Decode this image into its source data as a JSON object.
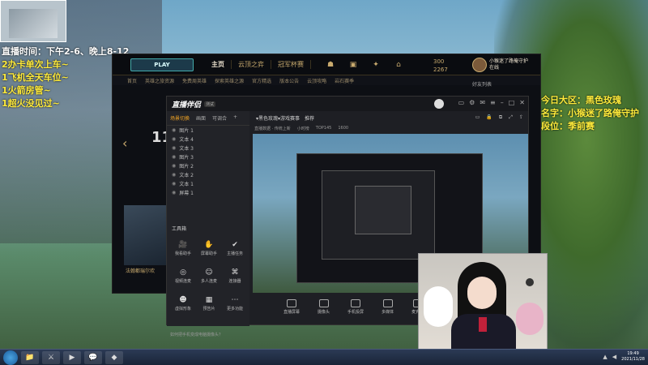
{
  "overlay_left": {
    "lines": [
      "直播时间：下午2-6、晚上8-12",
      "2办卡单次上车~",
      "1飞机全天车位~",
      "1火箭房管~",
      "1超火没见过~"
    ]
  },
  "overlay_right": {
    "lines": [
      "今日大区：黑色玫瑰",
      "名字：小猴迷了路俺守护",
      "段位：季前赛"
    ]
  },
  "lol": {
    "play": "PLAY",
    "nav": [
      "主页",
      "云顶之弈",
      "冠军杯赛"
    ],
    "top_icons": [
      "生涯",
      "藏品",
      "战利品",
      "商城"
    ],
    "currency": [
      "300",
      "2267"
    ],
    "username": "小猴迷了路俺守护",
    "status": "在线",
    "sub_nav": [
      "首页",
      "英雄之旅资源",
      "免费周英雄",
      "探索英雄之源",
      "官方精选",
      "版本公告",
      "云顶攻略",
      "岩石赛季"
    ],
    "friends_label": "好友列表",
    "big_text": "11",
    "card_title": "法翰都瑞尔欢"
  },
  "obs": {
    "logo": "直播伴侣",
    "version": "测试",
    "tabs": [
      "场景切换",
      "画面",
      "可调合"
    ],
    "sources": [
      "图片 1",
      "文本 4",
      "文本 3",
      "图片 3",
      "图片 2",
      "文本 2",
      "文本 1",
      "屏幕 1"
    ],
    "tools_title": "工具箱",
    "tools": [
      {
        "label": "我看助手",
        "icon": "🎥"
      },
      {
        "label": "屏幕助手",
        "icon": "✋"
      },
      {
        "label": "主播任务",
        "icon": "✔"
      },
      {
        "label": "视频连麦",
        "icon": "◎"
      },
      {
        "label": "多人连麦",
        "icon": "☺"
      },
      {
        "label": "连接器",
        "icon": "⌘"
      },
      {
        "label": "虚拟形象",
        "icon": "☻"
      },
      {
        "label": "预告片",
        "icon": "▦"
      },
      {
        "label": "更多功能",
        "icon": "⋯"
      }
    ],
    "topbar": [
      "▾黑色玫瑰▾游戏赛事",
      "推荐"
    ],
    "topbar2": [
      "直播数据 · 传统上新",
      "小时榜",
      "TOP145",
      "1600"
    ],
    "controls": [
      "直播屏幕",
      "摄像头",
      "手机投屏",
      "多媒体",
      "麦克风"
    ],
    "tip": "如何把手机变成电脑摄像头？"
  },
  "taskbar": {
    "time": "19:49",
    "date": "2021/11/28"
  }
}
